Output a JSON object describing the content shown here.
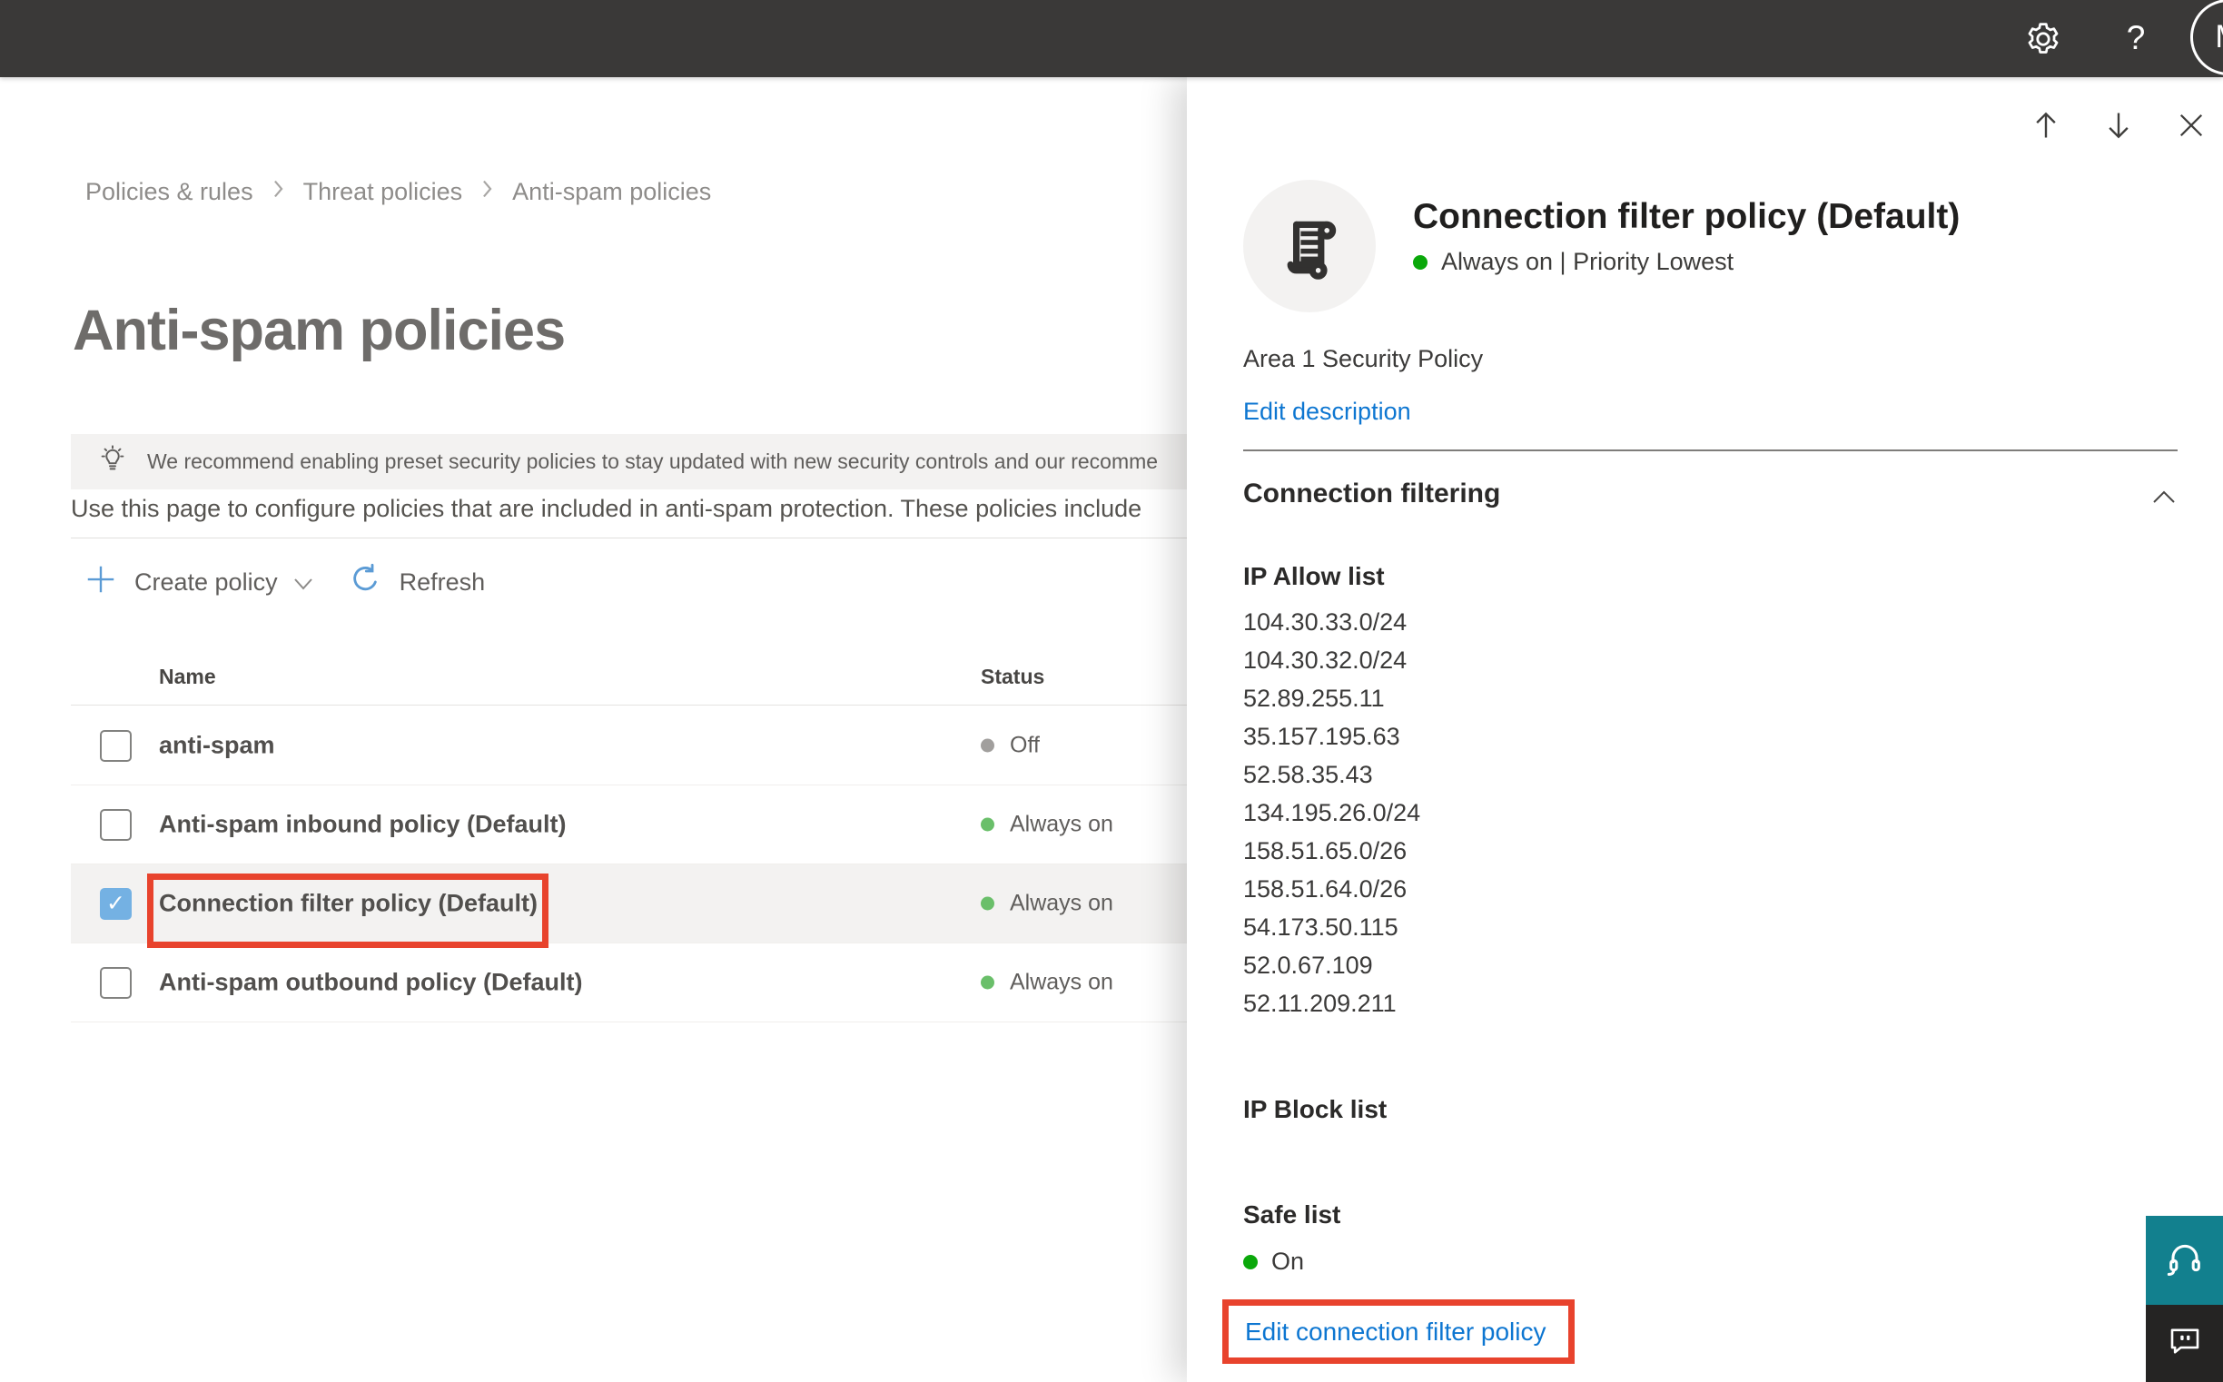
{
  "topbar": {
    "help_glyph": "?",
    "avatar_initial": "M"
  },
  "breadcrumb": {
    "items": [
      "Policies & rules",
      "Threat policies",
      "Anti-spam policies"
    ]
  },
  "page": {
    "title": "Anti-spam policies",
    "banner_text": "We recommend enabling preset security policies to stay updated with new security controls and our recomme",
    "description": "Use this page to configure policies that are included in anti-spam protection. These policies include"
  },
  "toolbar": {
    "create_policy_label": "Create policy",
    "refresh_label": "Refresh"
  },
  "table": {
    "columns": [
      "Name",
      "Status"
    ],
    "rows": [
      {
        "name": "anti-spam",
        "status": "Off"
      },
      {
        "name": "Anti-spam inbound policy (Default)",
        "status": "Always on"
      },
      {
        "name": "Connection filter policy (Default)",
        "status": "Always on"
      },
      {
        "name": "Anti-spam outbound policy (Default)",
        "status": "Always on"
      }
    ]
  },
  "panel": {
    "title": "Connection filter policy (Default)",
    "status_text": "Always on | Priority Lowest",
    "description": "Area 1 Security Policy",
    "edit_description_label": "Edit description",
    "section_title": "Connection filtering",
    "ip_allow_label": "IP Allow list",
    "ip_allow": [
      "104.30.33.0/24",
      "104.30.32.0/24",
      "52.89.255.11",
      "35.157.195.63",
      "52.58.35.43",
      "134.195.26.0/24",
      "158.51.65.0/26",
      "158.51.64.0/26",
      "54.173.50.115",
      "52.0.67.109",
      "52.11.209.211"
    ],
    "ip_block_label": "IP Block list",
    "safe_list_label": "Safe list",
    "safe_list_value": "On",
    "edit_link_label": "Edit connection filter policy"
  },
  "colors": {
    "accent_blue": "#0d76d1",
    "annotation_red": "#e8432d",
    "checkbox_blue": "#74b1e3",
    "status_green_table": "#6abf6a",
    "status_green_panel": "#0aa80a",
    "status_gray": "#a19f9d",
    "topbar_dark": "#3a3938",
    "help_teal": "#12808e",
    "feedback_dark": "#252423"
  }
}
